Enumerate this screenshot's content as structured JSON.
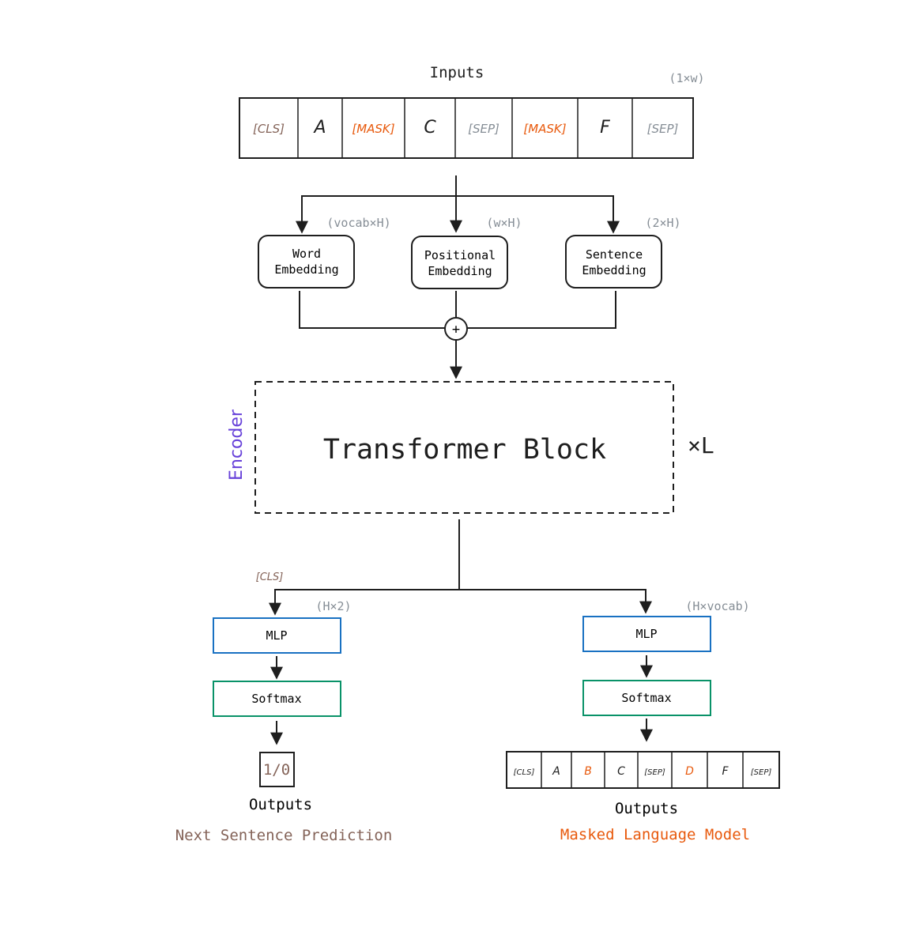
{
  "colors": {
    "ink": "#1e1e1e",
    "dim": "#868e96",
    "brown": "#846358",
    "orange": "#e8590c",
    "purple": "#6741d9",
    "blue": "#1971c2",
    "green": "#099268"
  },
  "inputs": {
    "title": "Inputs",
    "dim": "(1×w)",
    "tokens": [
      {
        "text": "[CLS]",
        "color": "brown"
      },
      {
        "text": "A",
        "color": "ink"
      },
      {
        "text": "[MASK]",
        "color": "orange"
      },
      {
        "text": "C",
        "color": "ink"
      },
      {
        "text": "[SEP]",
        "color": "dim"
      },
      {
        "text": "[MASK]",
        "color": "orange"
      },
      {
        "text": "F",
        "color": "ink"
      },
      {
        "text": "[SEP]",
        "color": "dim"
      }
    ]
  },
  "embeddings": [
    {
      "line1": "Word",
      "line2": "Embedding",
      "dim": "(vocab×H)"
    },
    {
      "line1": "Positional",
      "line2": "Embedding",
      "dim": "(w×H)"
    },
    {
      "line1": "Sentence",
      "line2": "Embedding",
      "dim": "(2×H)"
    }
  ],
  "sum_symbol": "+",
  "encoder": {
    "label": "Encoder",
    "block": "Transformer Block",
    "repeat": "×L"
  },
  "nsp": {
    "cls_label": "[CLS]",
    "dim": "(H×2)",
    "mlp": "MLP",
    "softmax": "Softmax",
    "output": "1/0",
    "outputs_label": "Outputs",
    "task": "Next Sentence Prediction"
  },
  "mlm": {
    "dim": "(H×vocab)",
    "mlp": "MLP",
    "softmax": "Softmax",
    "tokens": [
      {
        "text": "[CLS]",
        "color": "ink"
      },
      {
        "text": "A",
        "color": "ink"
      },
      {
        "text": "B",
        "color": "orange"
      },
      {
        "text": "C",
        "color": "ink"
      },
      {
        "text": "[SEP]",
        "color": "ink"
      },
      {
        "text": "D",
        "color": "orange"
      },
      {
        "text": "F",
        "color": "ink"
      },
      {
        "text": "[SEP]",
        "color": "ink"
      }
    ],
    "outputs_label": "Outputs",
    "task": "Masked Language Model"
  }
}
